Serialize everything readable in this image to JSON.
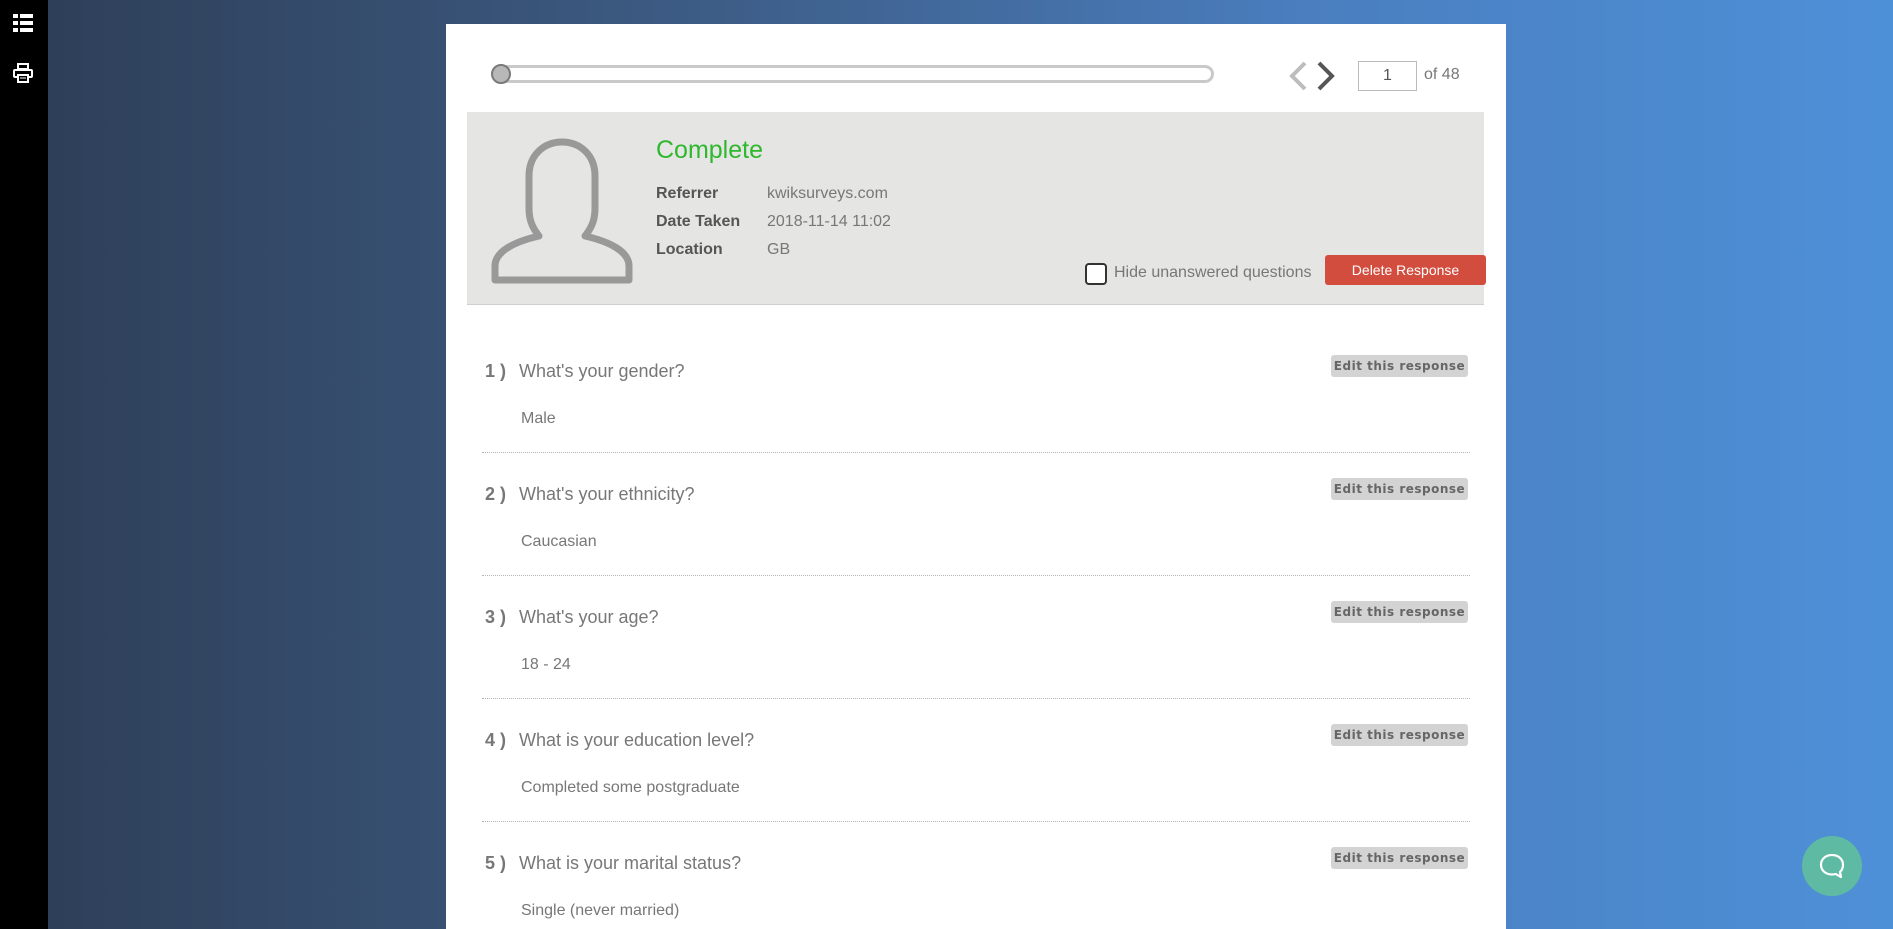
{
  "sidebar": {
    "icons": [
      "list-icon",
      "print-icon"
    ]
  },
  "pager": {
    "current_page": "1",
    "total_label": "of 48",
    "slider_position": 0.0
  },
  "response": {
    "status": "Complete",
    "status_color": "#2db82d",
    "meta": [
      {
        "label": "Referrer",
        "value": "kwiksurveys.com"
      },
      {
        "label": "Date Taken",
        "value": "2018-11-14 11:02"
      },
      {
        "label": "Location",
        "value": "GB"
      }
    ],
    "hide_unanswered_label": "Hide unanswered questions",
    "delete_label": "Delete Response",
    "delete_color": "#d24d3e"
  },
  "edit_label": "Edit this response",
  "questions": [
    {
      "num": "1 )",
      "text": "What's your gender?",
      "answer": "Male"
    },
    {
      "num": "2 )",
      "text": "What's your ethnicity?",
      "answer": "Caucasian"
    },
    {
      "num": "3 )",
      "text": "What's your age?",
      "answer": "18 - 24"
    },
    {
      "num": "4 )",
      "text": "What is your education level?",
      "answer": "Completed some postgraduate"
    },
    {
      "num": "5 )",
      "text": "What is your marital status?",
      "answer": "Single (never married)"
    }
  ],
  "chat": {
    "icon": "chat-bubble-icon",
    "color": "#5fbaa3"
  }
}
